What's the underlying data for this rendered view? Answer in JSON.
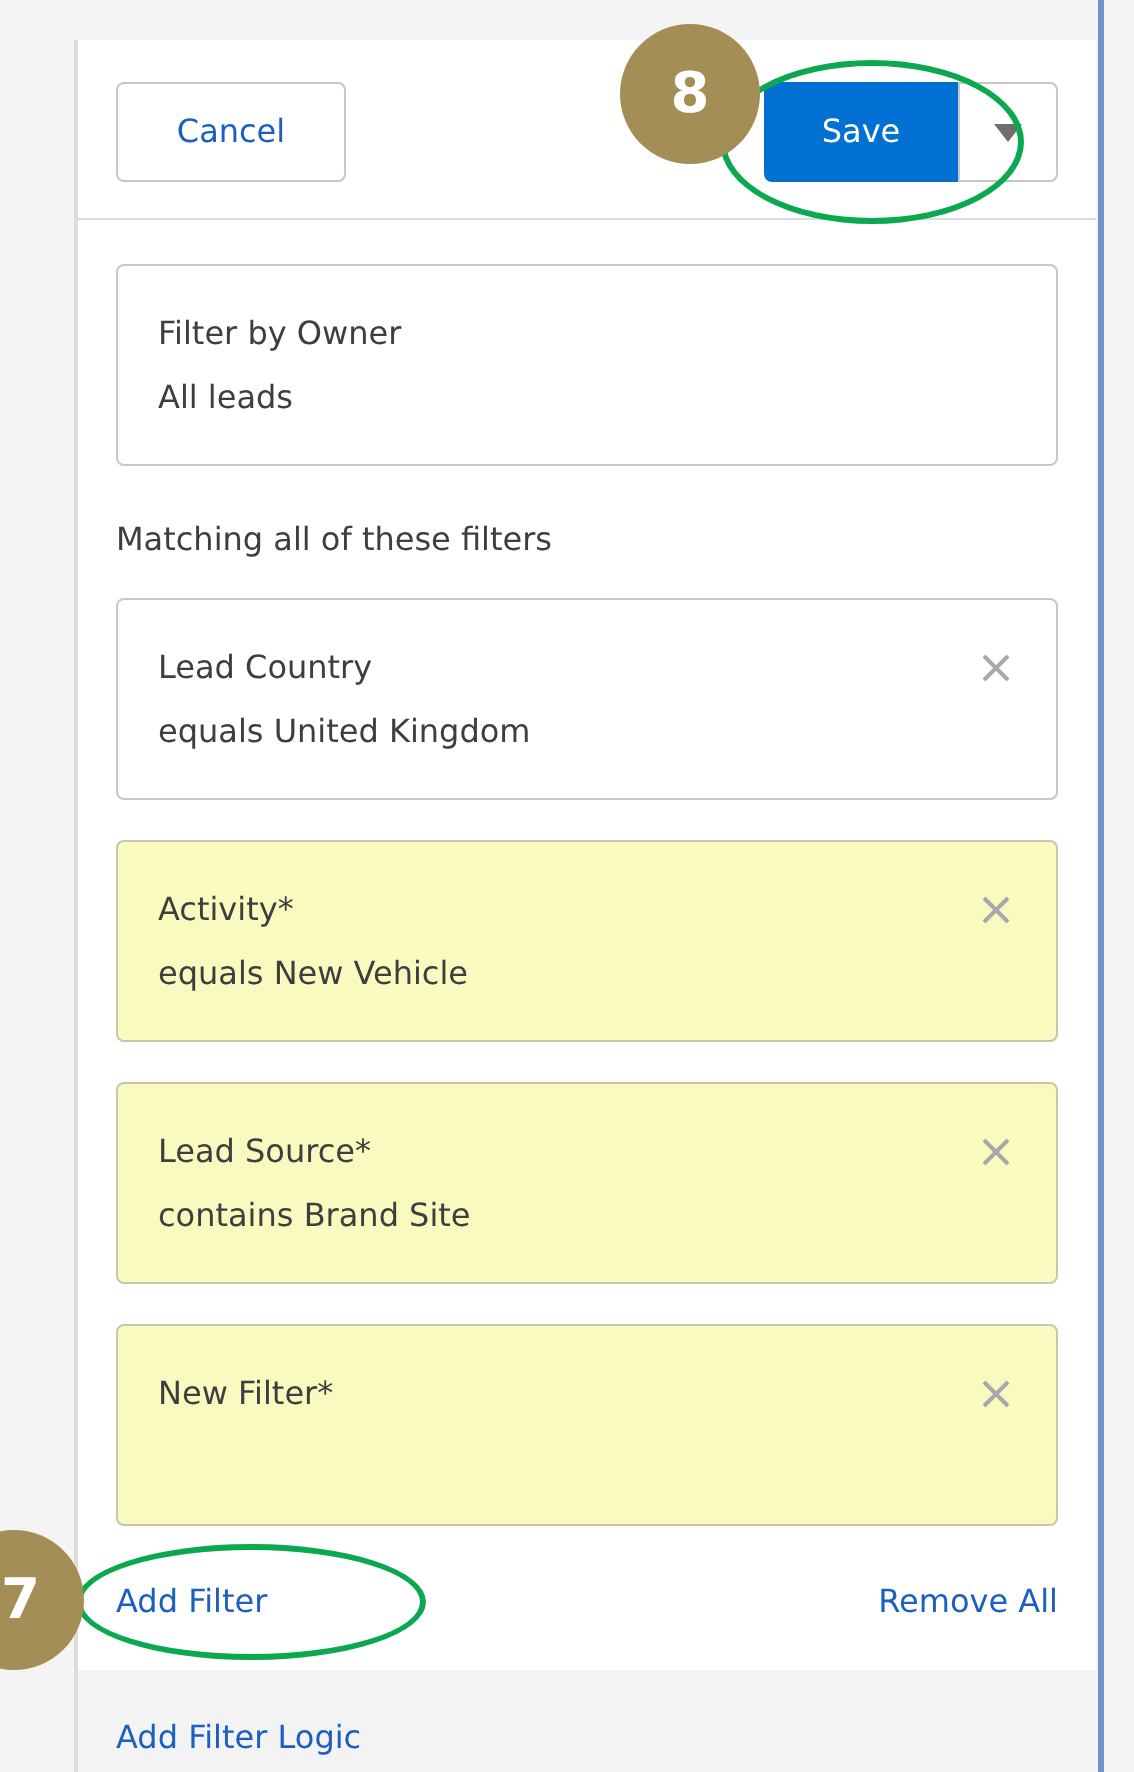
{
  "header": {
    "cancel": "Cancel",
    "save": "Save"
  },
  "owner_filter": {
    "label": "Filter by Owner",
    "value": "All leads"
  },
  "filters_heading": "Matching all of these filters",
  "filters": [
    {
      "field": "Lead Country",
      "operator": "equals",
      "value": "United Kingdom",
      "modified": false
    },
    {
      "field": "Activity*",
      "operator": "equals",
      "value": "New Vehicle",
      "modified": true
    },
    {
      "field": "Lead Source*",
      "operator": "contains",
      "value": "Brand Site",
      "modified": true
    },
    {
      "field": "New Filter*",
      "modified": true
    }
  ],
  "actions": {
    "add_filter": "Add Filter",
    "remove_all": "Remove All"
  },
  "footer": {
    "add_filter_logic": "Add Filter Logic"
  },
  "callouts": [
    {
      "label": "8",
      "kind": "save"
    },
    {
      "label": "7",
      "kind": "add_filter"
    }
  ]
}
